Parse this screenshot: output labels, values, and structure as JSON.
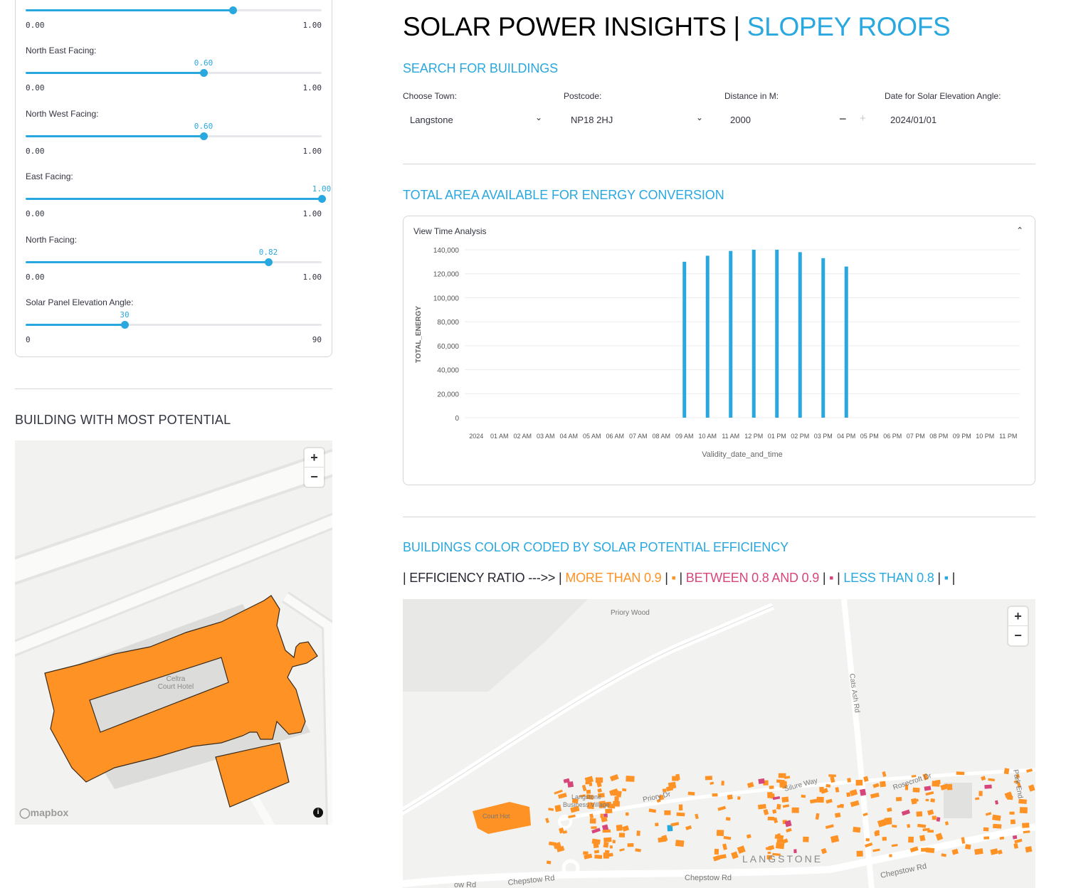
{
  "sidebar": {
    "sliders": [
      {
        "label": "",
        "value": "",
        "value_fraction": 0.7,
        "min": "0.00",
        "max": "1.00"
      },
      {
        "label": "North East Facing:",
        "value": "0.60",
        "value_fraction": 0.6,
        "min": "0.00",
        "max": "1.00"
      },
      {
        "label": "North West Facing:",
        "value": "0.60",
        "value_fraction": 0.6,
        "min": "0.00",
        "max": "1.00"
      },
      {
        "label": "East Facing:",
        "value": "1.00",
        "value_fraction": 1.0,
        "min": "0.00",
        "max": "1.00"
      },
      {
        "label": "North Facing:",
        "value": "0.82",
        "value_fraction": 0.82,
        "min": "0.00",
        "max": "1.00"
      },
      {
        "label": "Solar Panel Elevation Angle:",
        "value": "30",
        "value_fraction": 0.3333,
        "min": "0",
        "max": "90"
      }
    ],
    "building_heading": "BUILDING WITH MOST POTENTIAL",
    "map": {
      "hotel_label_1": "Celtra",
      "hotel_label_2": "Court Hotel",
      "attribution": "mapbox",
      "zoom_in": "+",
      "zoom_out": "−",
      "info": "i"
    }
  },
  "header": {
    "title_main": "SOLAR POWER INSIGHTS | ",
    "title_accent": "SLOPEY ROOFS"
  },
  "search": {
    "heading": "SEARCH FOR BUILDINGS",
    "town_label": "Choose Town:",
    "town_value": "Langstone",
    "postcode_label": "Postcode:",
    "postcode_value": "NP18 2HJ",
    "distance_label": "Distance in M:",
    "distance_value": "2000",
    "minus": "−",
    "plus": "+",
    "date_label": "Date for Solar Elevation Angle:",
    "date_value": "2024/01/01"
  },
  "energy": {
    "heading": "TOTAL AREA AVAILABLE FOR ENERGY CONVERSION",
    "expander_label": "View Time Analysis",
    "expander_icon": "chevron-up-icon"
  },
  "chart_data": {
    "type": "bar",
    "xlabel": "Validity_date_and_time",
    "ylabel": "TOTAL_ENERGY",
    "ylim": [
      0,
      140000
    ],
    "yticks": [
      "0",
      "20,000",
      "40,000",
      "60,000",
      "80,000",
      "100,000",
      "120,000",
      "140,000"
    ],
    "categories": [
      "2024",
      "01 AM",
      "02 AM",
      "03 AM",
      "04 AM",
      "05 AM",
      "06 AM",
      "07 AM",
      "08 AM",
      "09 AM",
      "10 AM",
      "11 AM",
      "12 PM",
      "01 PM",
      "02 PM",
      "03 PM",
      "04 PM",
      "05 PM",
      "06 PM",
      "07 PM",
      "08 PM",
      "09 PM",
      "10 PM",
      "11 PM"
    ],
    "values": [
      0,
      0,
      0,
      0,
      0,
      0,
      0,
      0,
      0,
      130000,
      135000,
      139000,
      140000,
      140000,
      138000,
      133000,
      126000,
      0,
      0,
      0,
      0,
      0,
      0,
      0
    ],
    "grid": true,
    "color": "#29a8e0"
  },
  "efficiency": {
    "heading": "BUILDINGS COLOR CODED BY SOLAR POTENTIAL EFFICIENCY",
    "legend_prefix": "| EFFICIENCY RATIO --->> | ",
    "more_label": "MORE THAN 0.9",
    "sep": " | ",
    "between_label": "BETWEEN 0.8 AND 0.9",
    "less_label": "LESS THAN 0.8",
    "end": " |",
    "colors": {
      "high": "#ff9224",
      "mid": "#d6467b",
      "low": "#29a8e0"
    },
    "map": {
      "labels": [
        "Priory Wood",
        "Cats Ash Rd",
        "Silure Way",
        "Rosecroft Dr",
        "Park End",
        "Priory Dr",
        "Langstone",
        "Business Village",
        "Court Hot",
        "LANGSTONE",
        "Chepstow Rd",
        "Chepstow Rd",
        "Chepstow Rd",
        "ow Rd"
      ],
      "zoom_in": "+",
      "zoom_out": "−"
    }
  }
}
